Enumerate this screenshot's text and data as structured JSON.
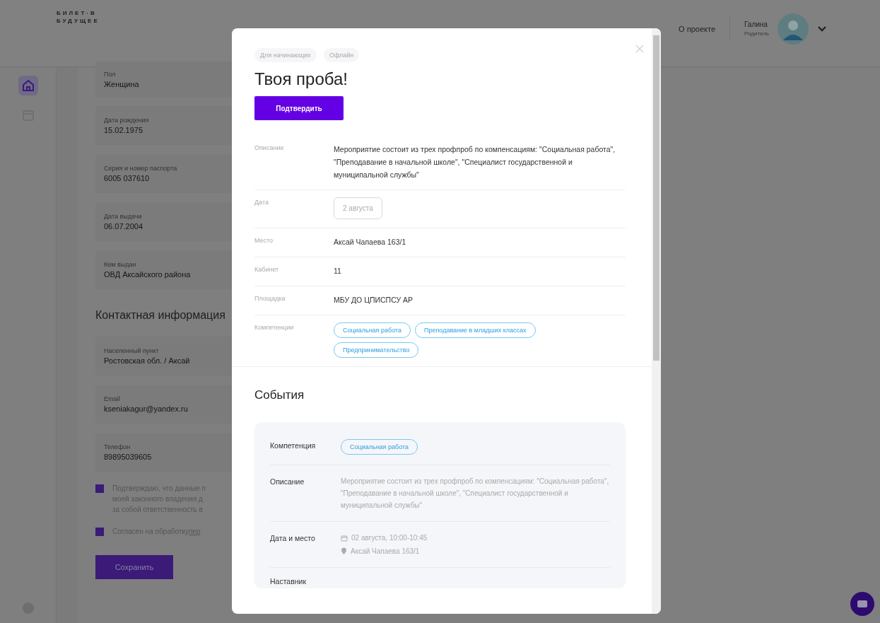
{
  "logo": [
    "БИЛЕТ·В",
    "БУДУЩЕЕ"
  ],
  "header": {
    "about_link": "О проекте",
    "user": {
      "name": "Галина",
      "role": "Родитель"
    }
  },
  "sidebar": {
    "items": [
      {
        "kind": "home",
        "selected": true
      },
      {
        "kind": "calendar",
        "selected": false
      }
    ]
  },
  "profile": {
    "fields": [
      {
        "label": "Пол",
        "value": "Женщина"
      },
      {
        "label": "Дата рождения",
        "value": "15.02.1975"
      },
      {
        "label": "Серия и номер паспорта",
        "value": "6005 037610"
      },
      {
        "label": "Дата выдачи",
        "value": "06.07.2004"
      },
      {
        "label": "Кем выдан",
        "value": "ОВД Аксайского района"
      }
    ],
    "contact_heading": "Контактная информация",
    "contact_fields": [
      {
        "label": "Населенный пункт",
        "value": "Ростовская обл. / Аксай"
      },
      {
        "label": "Email",
        "value": "kseniakagur@yandex.ru"
      },
      {
        "label": "Телефон",
        "value": "89895039605"
      }
    ],
    "consents": [
      {
        "lines": [
          "Подтверждаю, что данные п",
          "моей законного владения д",
          "за собой ответственность в"
        ],
        "checked": true
      },
      {
        "lines": [
          "Согласен на обработку"
        ],
        "link": "пер",
        "checked": true
      }
    ],
    "save_button": "Сохранить"
  },
  "modal": {
    "tags": [
      "Для начинающих",
      "Офлайн"
    ],
    "title": "Твоя проба!",
    "confirm_button": "Подтвердить",
    "details": [
      {
        "kind": "text",
        "label": "Описание",
        "value": "Мероприятие состоит из трех профпроб по компенсациям: \"Социальная работа\", \"Преподавание в начальной школе\", \"Специалист государственной и муниципальной службы\""
      },
      {
        "kind": "date",
        "label": "Дата",
        "value": "2 августа"
      },
      {
        "kind": "text",
        "label": "Место",
        "value": "Аксай Чапаева 163/1"
      },
      {
        "kind": "text",
        "label": "Кабинет",
        "value": "11"
      },
      {
        "kind": "text",
        "label": "Площадка",
        "value": "МБУ ДО ЦПИСПСУ АР"
      },
      {
        "kind": "chips",
        "label": "Компетенции",
        "chips": [
          "Социальная работа",
          "Преподавание в младших классах",
          "Предпринимательство"
        ]
      }
    ],
    "events_heading": "События",
    "event": {
      "competence_label": "Компетенция",
      "competence": "Социальная работа",
      "description_label": "Описание",
      "description": "Мероприятие состоит из трех профпроб по компенсациям: \"Социальная работа\", \"Преподавание в начальной школе\", \"Специалист государственной и муниципальной службы\"",
      "datetime_label": "Дата и место",
      "datetime": "02 августа, 10:00-10:45",
      "place": "Аксай Чапаева 163/1",
      "next_label": "Наставник"
    }
  }
}
